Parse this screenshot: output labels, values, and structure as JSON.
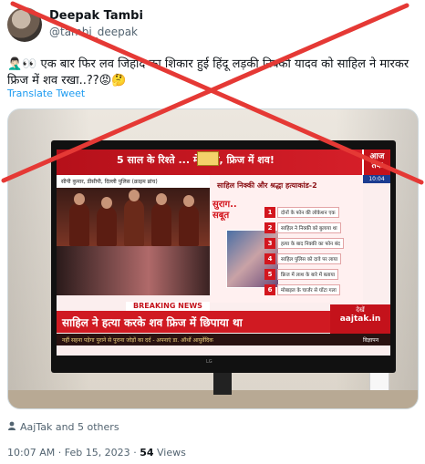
{
  "author": {
    "name": "Deepak Tambi",
    "handle": "@tambi_deepak"
  },
  "tweet": {
    "text": "🤦🏻‍♂️👀 एक बार फिर लव जिहाद का शिकार हुई हिंदू लड़की निक्की यादव को साहिल ने मारकर फ्रिज में शव रखा..??😡🤔",
    "translate_label": "Translate Tweet"
  },
  "tv_screen": {
    "headline": "5 साल के रिश्ते ... में हत्या, फ्रिज में शव!",
    "logo": "आज तक",
    "time": "10:04",
    "caption": "सीपी कुमार, डीसीपी, दिल्ली पुलिस (क्राइम ब्रांच)",
    "right_title": "साहिल निक्की और श्रद्धा हत्याकांड-2",
    "saboot": "सुराग.. सबूत",
    "clues": [
      {
        "num": "1",
        "text": "दोनों के फोन की लोकेशन एक"
      },
      {
        "num": "2",
        "text": "साहिल ने निक्की को बुलाया था"
      },
      {
        "num": "3",
        "text": "हत्या के बाद निक्की का फोन बंद"
      },
      {
        "num": "4",
        "text": "साहिल पुलिस को दावे पर लाया"
      },
      {
        "num": "5",
        "text": "फ्रिज में लाश के बारे में बताया"
      },
      {
        "num": "6",
        "text": "मोबाइल के चार्जर से घोंटा गला"
      }
    ],
    "breaking": "BREAKING NEWS",
    "bottom_bar": "साहिल ने हत्या करके शव फ्रिज में छिपाया था",
    "dekhen": "देखें",
    "site": "aajtak.in",
    "ticker": "नहीं सहना पड़ेगा पुराने से पुराना जोड़ों का दर्द - अपनाएं डा. ऑर्थो आयुर्वेदिक",
    "ad_label": "विज्ञापन",
    "tv_brand": "LG"
  },
  "liked_by": "AajTak and 5 others",
  "meta": {
    "time": "10:07 AM",
    "separator": "·",
    "date": "Feb 15, 2023",
    "views_count": "54",
    "views_label": "Views"
  },
  "colors": {
    "cross": "#e53935",
    "link": "#1d9bf0",
    "muted": "#536471",
    "news_red": "#d01a22"
  },
  "icons": [
    "person-icon"
  ]
}
